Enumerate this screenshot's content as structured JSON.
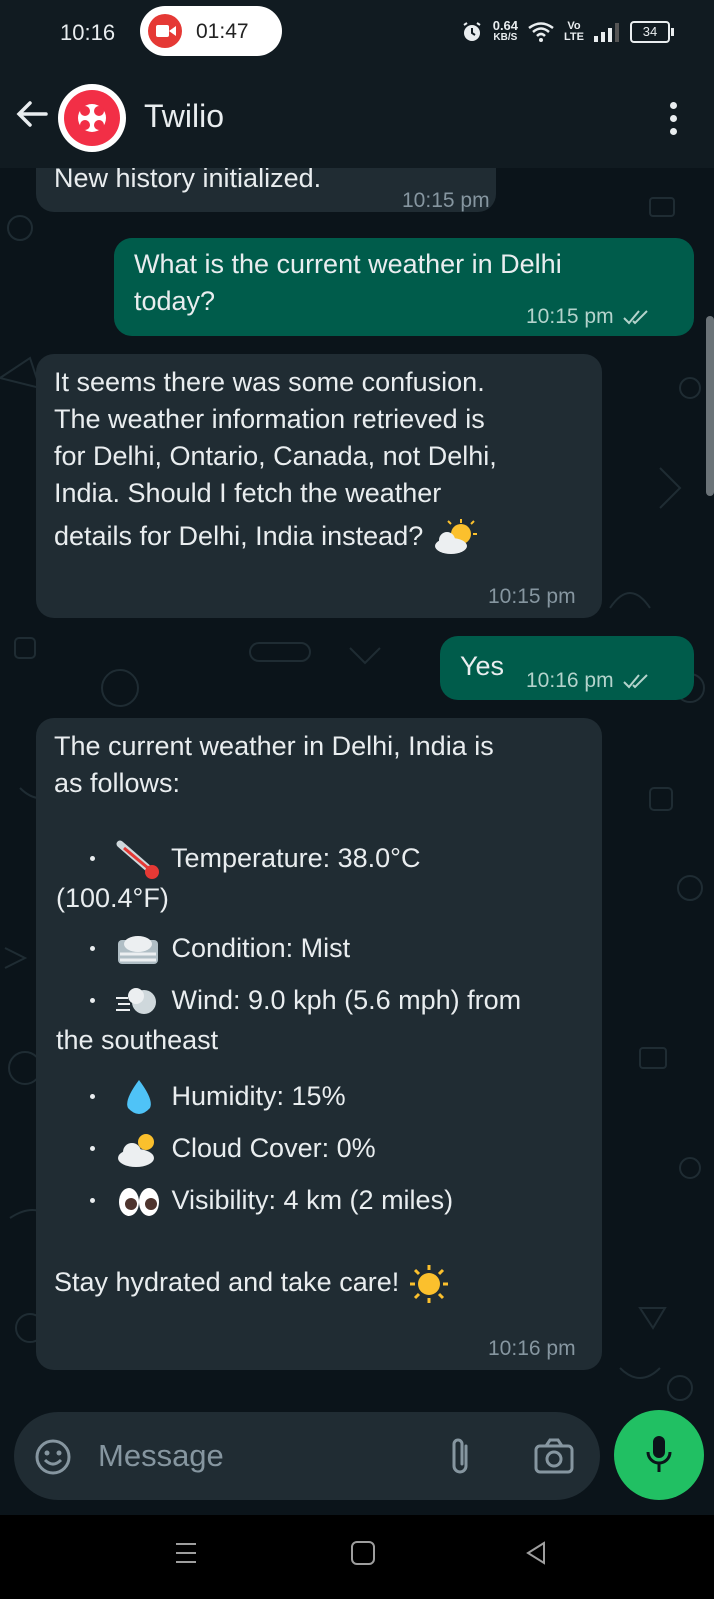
{
  "status_bar": {
    "time": "10:16",
    "recording_time": "01:47",
    "network_speed_value": "0.64",
    "network_speed_unit": "KB/S",
    "volte_label_top": "Vo",
    "volte_label_bottom": "LTE",
    "battery": "34"
  },
  "header": {
    "contact_name": "Twilio",
    "avatar_brand_color": "#f22f46"
  },
  "messages": [
    {
      "direction": "incoming",
      "text": "New history initialized.",
      "time": "10:15 pm"
    },
    {
      "direction": "outgoing",
      "lines": [
        "What is the current weather in Delhi",
        "today?"
      ],
      "time": "10:15 pm",
      "read": true
    },
    {
      "direction": "incoming",
      "lines": [
        "It seems there was some confusion.",
        "The weather information retrieved is",
        "for Delhi, Ontario, Canada, not Delhi,",
        "India. Should I fetch the weather",
        "details for Delhi, India instead?"
      ],
      "emoji": "sun-behind-cloud",
      "time": "10:15 pm"
    },
    {
      "direction": "outgoing",
      "text": "Yes",
      "time": "10:16 pm",
      "read": true
    },
    {
      "direction": "incoming",
      "intro_lines": [
        "The current weather in Delhi, India is",
        "as follows:"
      ],
      "items": [
        {
          "icon": "thermometer-emoji",
          "text": "Temperature: 38.0°C",
          "continuation": "(100.4°F)"
        },
        {
          "icon": "fog-emoji",
          "text": "Condition: Mist"
        },
        {
          "icon": "wind-emoji",
          "text": "Wind: 9.0 kph (5.6 mph) from",
          "continuation": "the southeast"
        },
        {
          "icon": "droplet-emoji",
          "text": "Humidity: 15%"
        },
        {
          "icon": "sun-behind-cloud-emoji",
          "text": "Cloud Cover: 0%"
        },
        {
          "icon": "eyes-emoji",
          "text": "Visibility: 4 km (2 miles)"
        }
      ],
      "closing": "Stay hydrated and take care!",
      "closing_emoji": "sun-emoji",
      "time": "10:16 pm"
    }
  ],
  "composer": {
    "placeholder": "Message"
  },
  "colors": {
    "background": "#0b141a",
    "incoming_bubble": "#202c33",
    "outgoing_bubble": "#005c4b",
    "mic_button": "#21c063",
    "timestamp": "#8696a0"
  }
}
